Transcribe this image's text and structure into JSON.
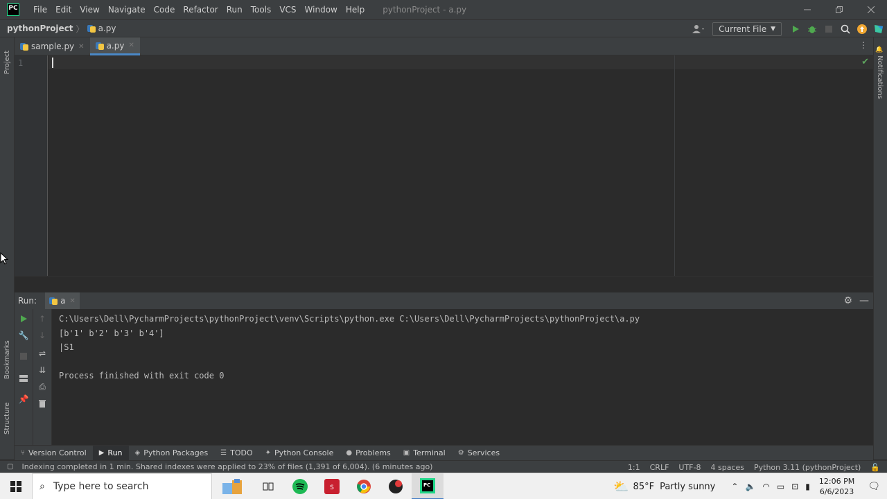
{
  "titlebar": {
    "logo": "PC",
    "menu": [
      "File",
      "Edit",
      "View",
      "Navigate",
      "Code",
      "Refactor",
      "Run",
      "Tools",
      "VCS",
      "Window",
      "Help"
    ],
    "window_title": "pythonProject - a.py"
  },
  "navbar": {
    "project": "pythonProject",
    "file": "a.py",
    "run_config": "Current File"
  },
  "left_strip": {
    "project": "Project",
    "bookmarks": "Bookmarks",
    "structure": "Structure"
  },
  "right_strip": {
    "notifications": "Notifications"
  },
  "editor": {
    "tabs": [
      {
        "label": "sample.py",
        "active": false
      },
      {
        "label": "a.py",
        "active": true
      }
    ],
    "line_numbers": [
      "1"
    ]
  },
  "run_panel": {
    "label": "Run:",
    "tab": "a",
    "console": [
      "C:\\Users\\Dell\\PycharmProjects\\pythonProject\\venv\\Scripts\\python.exe C:\\Users\\Dell\\PycharmProjects\\pythonProject\\a.py",
      "[b'1' b'2' b'3' b'4']",
      "|S1",
      "",
      "Process finished with exit code 0"
    ]
  },
  "toolwindows": [
    {
      "label": "Version Control",
      "icon": "branch-icon"
    },
    {
      "label": "Run",
      "icon": "run-icon",
      "active": true
    },
    {
      "label": "Python Packages",
      "icon": "packages-icon"
    },
    {
      "label": "TODO",
      "icon": "todo-icon"
    },
    {
      "label": "Python Console",
      "icon": "console-icon"
    },
    {
      "label": "Problems",
      "icon": "problems-icon"
    },
    {
      "label": "Terminal",
      "icon": "terminal-icon"
    },
    {
      "label": "Services",
      "icon": "services-icon"
    }
  ],
  "statusbar": {
    "message": "Indexing completed in 1 min. Shared indexes were applied to 23% of files (1,391 of 6,004). (6 minutes ago)",
    "position": "1:1",
    "line_sep": "CRLF",
    "encoding": "UTF-8",
    "indent": "4 spaces",
    "interpreter": "Python 3.11 (pythonProject)"
  },
  "taskbar": {
    "search_placeholder": "Type here to search",
    "weather_temp": "85°F",
    "weather_desc": "Partly sunny",
    "time": "12:06 PM",
    "date": "6/6/2023"
  },
  "colors": {
    "run_green": "#4fa94f",
    "tab_underline": "#4a88c7"
  }
}
